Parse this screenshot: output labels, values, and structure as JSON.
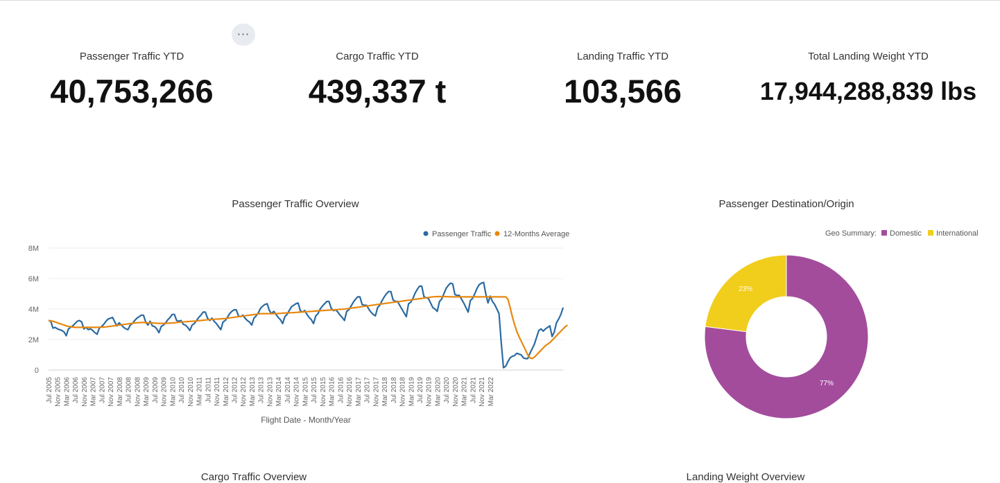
{
  "more_button": {
    "label": "···",
    "icon": "more-horizontal-icon"
  },
  "kpis": [
    {
      "title": "Passenger Traffic YTD",
      "value": "40,753,266"
    },
    {
      "title": "Cargo Traffic YTD",
      "value": "439,337 t"
    },
    {
      "title": "Landing Traffic YTD",
      "value": "103,566"
    },
    {
      "title": "Total Landing Weight YTD",
      "value": "17,944,288,839 lbs"
    }
  ],
  "passenger_chart": {
    "title": "Passenger Traffic Overview",
    "legend": [
      "Passenger Traffic",
      "12-Months Average"
    ],
    "colors": [
      "#2b6aa1",
      "#e8870e"
    ],
    "xlabel": "Flight Date - Month/Year"
  },
  "geo_chart": {
    "title": "Passenger Destination/Origin",
    "legend_prefix": "Geo Summary:",
    "legend": [
      "Domestic",
      "International"
    ],
    "colors": [
      "#a34c9c",
      "#f1cd1c"
    ],
    "labels": [
      "77%",
      "23%"
    ]
  },
  "next_row": {
    "left_title": "Cargo Traffic Overview",
    "right_title": "Landing Weight Overview"
  },
  "chart_data": [
    {
      "type": "line",
      "title": "Passenger Traffic Overview",
      "xlabel": "Flight Date - Month/Year",
      "ylabel": "",
      "ylim": [
        0,
        8000000
      ],
      "y_ticks": [
        "0",
        "2M",
        "4M",
        "6M",
        "8M"
      ],
      "x_start": "Jul 2005",
      "x_end": "Jun 2022",
      "x_ticks": [
        "Jul 2005",
        "Nov 2005",
        "Mar 2006",
        "Jul 2006",
        "Nov 2006",
        "Mar 2007",
        "Jul 2007",
        "Nov 2007",
        "Mar 2008",
        "Jul 2008",
        "Nov 2008",
        "Mar 2009",
        "Jul 2009",
        "Nov 2009",
        "Mar 2010",
        "Jul 2010",
        "Nov 2010",
        "Mar 2011",
        "Jul 2011",
        "Nov 2011",
        "Mar 2012",
        "Jul 2012",
        "Nov 2012",
        "Mar 2013",
        "Jul 2013",
        "Nov 2013",
        "Mar 2014",
        "Jul 2014",
        "Nov 2014",
        "Mar 2015",
        "Jul 2015",
        "Nov 2015",
        "Mar 2016",
        "Jul 2016",
        "Nov 2016",
        "Mar 2017",
        "Jul 2017",
        "Nov 2017",
        "Mar 2018",
        "Jul 2018",
        "Nov 2018",
        "Mar 2019",
        "Jul 2019",
        "Nov 2019",
        "Mar 2020",
        "Jul 2020",
        "Nov 2020",
        "Mar 2021",
        "Jul 2021",
        "Nov 2021",
        "Mar 2022"
      ],
      "legend_position": "top-right",
      "grid": true,
      "series": [
        {
          "name": "Passenger Traffic",
          "values": [
            3250000,
            3200000,
            2750000,
            2800000,
            2700000,
            2650000,
            2600000,
            2500000,
            2250000,
            2700000,
            2800000,
            2900000,
            3050000,
            3200000,
            3250000,
            3150000,
            2700000,
            2800000,
            2650000,
            2700000,
            2600000,
            2450000,
            2350000,
            2750000,
            2850000,
            3000000,
            3200000,
            3350000,
            3400000,
            3450000,
            3150000,
            2900000,
            3100000,
            2950000,
            2800000,
            2700000,
            2650000,
            2950000,
            3050000,
            3250000,
            3400000,
            3500000,
            3600000,
            3600000,
            3150000,
            2950000,
            3200000,
            2900000,
            2850000,
            2700000,
            2450000,
            2850000,
            2950000,
            3100000,
            3300000,
            3450000,
            3650000,
            3650000,
            3250000,
            3200000,
            3250000,
            3000000,
            2950000,
            2800000,
            2600000,
            2950000,
            3050000,
            3250000,
            3450000,
            3600000,
            3800000,
            3800000,
            3400000,
            3250000,
            3400000,
            3200000,
            3050000,
            2850000,
            2650000,
            3150000,
            3250000,
            3450000,
            3700000,
            3850000,
            3950000,
            3950000,
            3550000,
            3500000,
            3600000,
            3400000,
            3250000,
            3150000,
            2950000,
            3400000,
            3550000,
            3750000,
            4050000,
            4200000,
            4300000,
            4350000,
            3900000,
            3700000,
            3850000,
            3650000,
            3450000,
            3300000,
            3050000,
            3500000,
            3650000,
            3900000,
            4150000,
            4250000,
            4350000,
            4400000,
            3900000,
            3800000,
            3900000,
            3650000,
            3450000,
            3300000,
            3050000,
            3550000,
            3700000,
            4000000,
            4200000,
            4350000,
            4500000,
            4500000,
            4050000,
            3900000,
            3950000,
            3800000,
            3600000,
            3450000,
            3250000,
            3850000,
            3950000,
            4200000,
            4450000,
            4650000,
            4800000,
            4800000,
            4300000,
            4250000,
            4250000,
            4000000,
            3800000,
            3650000,
            3550000,
            4100000,
            4250000,
            4550000,
            4800000,
            5000000,
            5150000,
            5150000,
            4600000,
            4500000,
            4500000,
            4250000,
            4000000,
            3750000,
            3500000,
            4350000,
            4450000,
            4700000,
            5050000,
            5300000,
            5500000,
            5500000,
            4800000,
            4750000,
            4700000,
            4400000,
            4100000,
            4000000,
            3850000,
            4500000,
            4650000,
            5000000,
            5350000,
            5550000,
            5700000,
            5650000,
            4950000,
            4900000,
            4900000,
            4650000,
            4400000,
            4100000,
            3800000,
            4550000,
            4700000,
            5000000,
            5350000,
            5600000,
            5700000,
            5750000,
            5000000,
            4400000,
            4850000,
            4500000,
            4300000,
            4000000,
            3700000,
            1800000,
            150000,
            250000,
            550000,
            800000,
            900000,
            950000,
            1100000,
            1050000,
            1000000,
            800000,
            750000,
            750000,
            1100000,
            1400000,
            1700000,
            2150000,
            2600000,
            2700000,
            2550000,
            2700000,
            2800000,
            2900000,
            2200000,
            2500000,
            3100000,
            3350000,
            3650000,
            4100000
          ]
        },
        {
          "name": "12-Months Average",
          "values": [
            3250000,
            3230000,
            3200000,
            3150000,
            3100000,
            3050000,
            3000000,
            2950000,
            2900000,
            2870000,
            2840000,
            2820000,
            2800000,
            2800000,
            2800000,
            2800000,
            2800000,
            2800000,
            2800000,
            2800000,
            2800000,
            2800000,
            2800000,
            2800000,
            2810000,
            2820000,
            2830000,
            2850000,
            2870000,
            2890000,
            2910000,
            2930000,
            2950000,
            2970000,
            2990000,
            3010000,
            3030000,
            3050000,
            3070000,
            3090000,
            3100000,
            3110000,
            3120000,
            3120000,
            3110000,
            3100000,
            3100000,
            3090000,
            3080000,
            3070000,
            3060000,
            3060000,
            3060000,
            3070000,
            3070000,
            3080000,
            3090000,
            3100000,
            3120000,
            3130000,
            3150000,
            3160000,
            3170000,
            3180000,
            3190000,
            3200000,
            3210000,
            3220000,
            3240000,
            3250000,
            3270000,
            3280000,
            3300000,
            3310000,
            3320000,
            3330000,
            3340000,
            3350000,
            3360000,
            3370000,
            3380000,
            3400000,
            3420000,
            3440000,
            3460000,
            3480000,
            3500000,
            3520000,
            3540000,
            3560000,
            3580000,
            3600000,
            3620000,
            3640000,
            3660000,
            3680000,
            3700000,
            3700000,
            3700000,
            3700000,
            3700000,
            3700000,
            3700000,
            3700000,
            3710000,
            3720000,
            3730000,
            3740000,
            3750000,
            3750000,
            3760000,
            3770000,
            3780000,
            3790000,
            3800000,
            3810000,
            3820000,
            3830000,
            3840000,
            3850000,
            3860000,
            3870000,
            3880000,
            3890000,
            3900000,
            3910000,
            3920000,
            3930000,
            3940000,
            3950000,
            3960000,
            3970000,
            3980000,
            3990000,
            4000000,
            4020000,
            4040000,
            4060000,
            4080000,
            4100000,
            4120000,
            4140000,
            4160000,
            4180000,
            4200000,
            4220000,
            4240000,
            4260000,
            4280000,
            4300000,
            4320000,
            4340000,
            4360000,
            4380000,
            4400000,
            4420000,
            4440000,
            4460000,
            4480000,
            4500000,
            4520000,
            4540000,
            4560000,
            4580000,
            4600000,
            4620000,
            4640000,
            4660000,
            4680000,
            4700000,
            4720000,
            4740000,
            4760000,
            4780000,
            4800000,
            4810000,
            4820000,
            4820000,
            4820000,
            4820000,
            4820000,
            4810000,
            4800000,
            4800000,
            4800000,
            4800000,
            4800000,
            4800000,
            4800000,
            4800000,
            4800000,
            4800000,
            4800000,
            4800000,
            4800000,
            4800000,
            4800000,
            4800000,
            4800000,
            4800000,
            4800000,
            4800000,
            4800000,
            4800000,
            4800000,
            4800000,
            4800000,
            4800000,
            4650000,
            4100000,
            3500000,
            3000000,
            2550000,
            2200000,
            1900000,
            1600000,
            1300000,
            1000000,
            800000,
            750000,
            850000,
            1000000,
            1150000,
            1300000,
            1450000,
            1600000,
            1700000,
            1800000,
            1950000,
            2100000,
            2250000,
            2400000,
            2550000,
            2700000,
            2850000,
            2950000
          ]
        }
      ]
    },
    {
      "type": "pie",
      "title": "Passenger Destination/Origin",
      "legend_title": "Geo Summary:",
      "legend_position": "top-right",
      "categories": [
        "Domestic",
        "International"
      ],
      "values": [
        77,
        23
      ],
      "labels": [
        "77%",
        "23%"
      ],
      "donut": true
    }
  ]
}
